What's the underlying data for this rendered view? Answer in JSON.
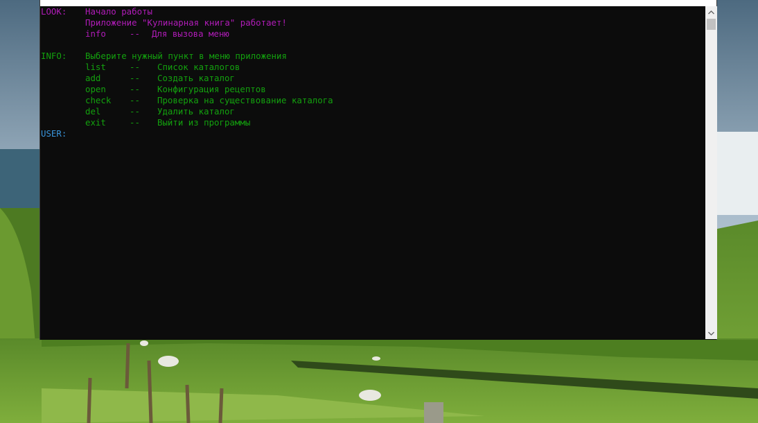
{
  "console": {
    "lines": [
      {
        "tag": "LOOK:",
        "text": "Начало работы",
        "color": "#b01cb8"
      },
      {
        "tag": "",
        "text": "Приложение \"Кулинарная книга\" работает!",
        "color": "#b01cb8"
      },
      {
        "tag": "",
        "cmd": "info",
        "sep": "--",
        "desc": "Для вызова меню",
        "color": "#b01cb8"
      },
      {
        "tag": "",
        "text": "",
        "color": "#b01cb8"
      },
      {
        "tag": "INFO:",
        "text": "Выберите нужный пункт в меню приложения",
        "color": "#13a10e"
      }
    ],
    "menu": [
      {
        "cmd": "list",
        "sep": "--",
        "desc": "Список каталогов"
      },
      {
        "cmd": "add",
        "sep": "--",
        "desc": "Создать каталог"
      },
      {
        "cmd": "open",
        "sep": "--",
        "desc": "Конфигурация рецептов"
      },
      {
        "cmd": "check",
        "sep": "--",
        "desc": "Проверка на существование каталога"
      },
      {
        "cmd": "del",
        "sep": "--",
        "desc": "Удалить каталог"
      },
      {
        "cmd": "exit",
        "sep": "--",
        "desc": "Выйти из программы"
      }
    ],
    "prompt": "USER:",
    "colors": {
      "look": "#b01cb8",
      "info": "#13a10e",
      "user": "#3a96dd",
      "background": "#0c0c0c"
    }
  },
  "scrollbar": {
    "up_icon": "chevron-up-icon",
    "down_icon": "chevron-down-icon"
  }
}
